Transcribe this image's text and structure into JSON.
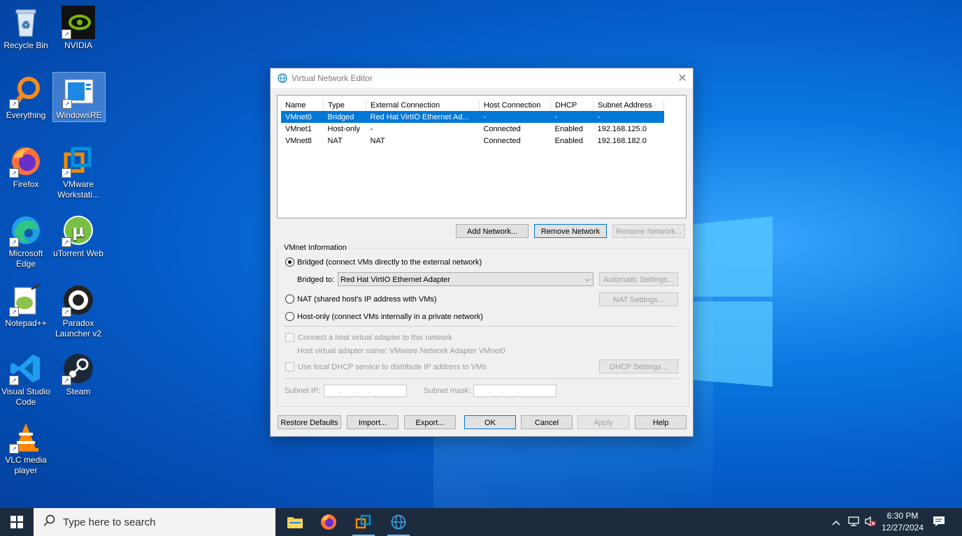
{
  "desktop_icons": [
    {
      "label": "Recycle Bin",
      "icon": "recycle-bin-icon"
    },
    {
      "label": "NVIDIA",
      "icon": "nvidia-icon"
    },
    {
      "label": "Everything",
      "icon": "everything-search-icon"
    },
    {
      "label": "WindowsRE",
      "icon": "windowsre-icon"
    },
    {
      "label": "Firefox",
      "icon": "firefox-icon"
    },
    {
      "label": "VMware Workstati...",
      "icon": "vmware-icon"
    },
    {
      "label": "Microsoft Edge",
      "icon": "edge-icon"
    },
    {
      "label": "uTorrent Web",
      "icon": "utorrent-icon"
    },
    {
      "label": "Notepad++",
      "icon": "notepadpp-icon"
    },
    {
      "label": "Paradox Launcher v2",
      "icon": "paradox-icon"
    },
    {
      "label": "Visual Studio Code",
      "icon": "vscode-icon"
    },
    {
      "label": "Steam",
      "icon": "steam-icon"
    },
    {
      "label": "VLC media player",
      "icon": "vlc-icon"
    }
  ],
  "dialog": {
    "title": "Virtual Network Editor",
    "columns": [
      "Name",
      "Type",
      "External Connection",
      "Host Connection",
      "DHCP",
      "Subnet Address"
    ],
    "rows": [
      [
        "VMnet0",
        "Bridged",
        "Red Hat VirtIO Ethernet Ad...",
        "-",
        "-",
        "-"
      ],
      [
        "VMnet1",
        "Host-only",
        "-",
        "Connected",
        "Enabled",
        "192.168.125.0"
      ],
      [
        "VMnet8",
        "NAT",
        "NAT",
        "Connected",
        "Enabled",
        "192.168.182.0"
      ]
    ],
    "selected_row": 0,
    "add_network": "Add Network...",
    "remove_network": "Remove Network",
    "rename_network": "Rename Network...",
    "vmnet_info": "VMnet Information",
    "bridged_label": "Bridged (connect VMs directly to the external network)",
    "bridged_to_label": "Bridged to:",
    "bridged_to_value": "Red Hat VirtIO Ethernet Adapter",
    "automatic_settings": "Automatic Settings...",
    "nat_label": "NAT (shared host's IP address with VMs)",
    "nat_settings": "NAT Settings...",
    "hostonly_label": "Host-only (connect VMs internally in a private network)",
    "connect_adapter_label": "Connect a host virtual adapter to this network",
    "adapter_name_label": "Host virtual adapter name: VMware Network Adapter VMnet0",
    "dhcp_label": "Use local DHCP service to distribute IP address to VMs",
    "dhcp_settings": "DHCP Settings...",
    "subnet_ip_label": "Subnet IP:",
    "subnet_mask_label": "Subnet mask:",
    "ip_dots": "...",
    "restore_defaults": "Restore Defaults",
    "import": "Import...",
    "export": "Export...",
    "ok": "OK",
    "cancel": "Cancel",
    "apply": "Apply",
    "help": "Help"
  },
  "taskbar": {
    "search_placeholder": "Type here to search",
    "time": "6:30 PM",
    "date": "12/27/2024"
  },
  "colors": {
    "accent": "#0078d7",
    "taskbar": "#1c2b3d"
  }
}
